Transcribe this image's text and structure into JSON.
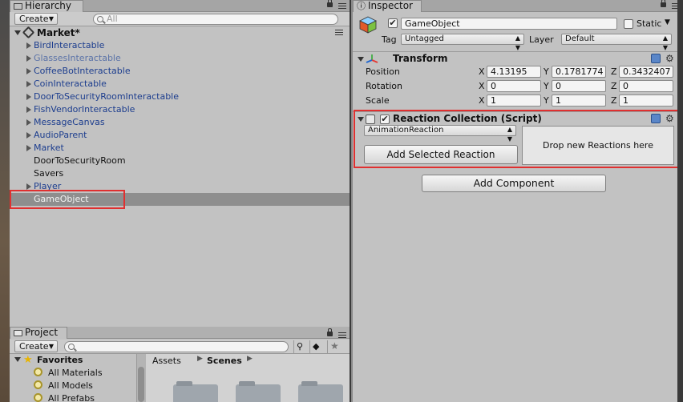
{
  "hierarchy": {
    "tab_label": "Hierarchy",
    "create_label": "Create",
    "search_placeholder": "All",
    "scene_name": "Market*",
    "items": [
      {
        "label": "BirdInteractable",
        "has_children": true,
        "style": "blue"
      },
      {
        "label": "GlassesInteractable",
        "has_children": true,
        "style": "greyblue"
      },
      {
        "label": "CoffeeBotInteractable",
        "has_children": true,
        "style": "blue"
      },
      {
        "label": "CoinInteractable",
        "has_children": true,
        "style": "blue"
      },
      {
        "label": "DoorToSecurityRoomInteractable",
        "has_children": true,
        "style": "blue"
      },
      {
        "label": "FishVendorInteractable",
        "has_children": true,
        "style": "blue"
      },
      {
        "label": "MessageCanvas",
        "has_children": true,
        "style": "blue"
      },
      {
        "label": "AudioParent",
        "has_children": true,
        "style": "blue"
      },
      {
        "label": "Market",
        "has_children": true,
        "style": "blue"
      },
      {
        "label": "DoorToSecurityRoom",
        "has_children": false,
        "style": "black"
      },
      {
        "label": "Savers",
        "has_children": false,
        "style": "black"
      },
      {
        "label": "Player",
        "has_children": true,
        "style": "blue"
      },
      {
        "label": "GameObject",
        "has_children": false,
        "style": "selected"
      }
    ]
  },
  "project": {
    "tab_label": "Project",
    "create_label": "Create",
    "favorites_label": "Favorites",
    "favorites": [
      "All Materials",
      "All Models",
      "All Prefabs"
    ],
    "breadcrumb_root": "Assets",
    "breadcrumb_current": "Scenes"
  },
  "inspector": {
    "tab_label": "Inspector",
    "object_name": "GameObject",
    "static_label": "Static",
    "tag_label": "Tag",
    "tag_value": "Untagged",
    "layer_label": "Layer",
    "layer_value": "Default",
    "transform": {
      "title": "Transform",
      "rows": [
        {
          "label": "Position",
          "x": "4.13195",
          "y": "0.1781774",
          "z": "0.3432407"
        },
        {
          "label": "Rotation",
          "x": "0",
          "y": "0",
          "z": "0"
        },
        {
          "label": "Scale",
          "x": "1",
          "y": "1",
          "z": "1"
        }
      ]
    },
    "reaction": {
      "title": "Reaction Collection (Script)",
      "dropdown_value": "AnimationReaction",
      "add_button": "Add Selected Reaction",
      "drop_zone": "Drop new Reactions here"
    },
    "add_component": "Add Component"
  },
  "axes": {
    "x": "X",
    "y": "Y",
    "z": "Z"
  }
}
